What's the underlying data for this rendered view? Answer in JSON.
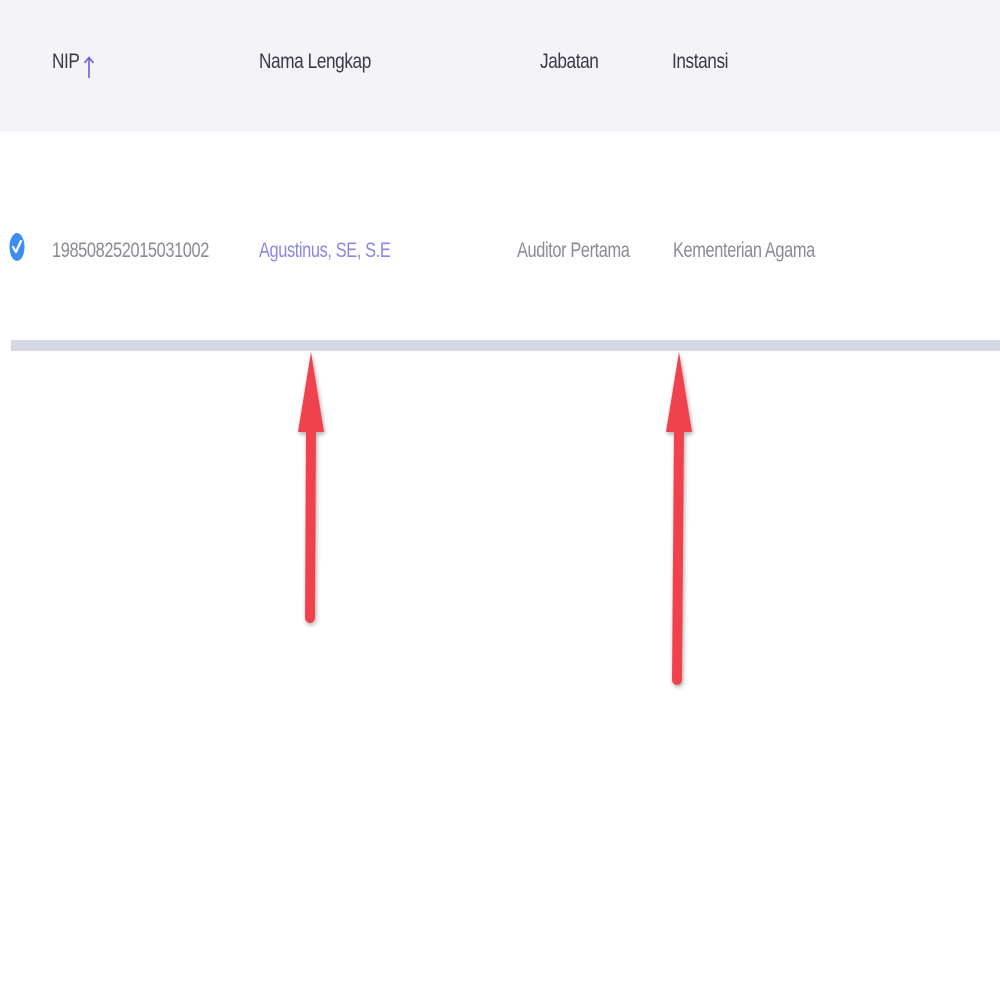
{
  "table": {
    "columns": {
      "nip": "NIP",
      "nama": "Nama Lengkap",
      "jabatan": "Jabatan",
      "instansi": "Instansi"
    },
    "sort": {
      "column": "NIP",
      "direction": "ascending",
      "icon": "arrow-up-icon"
    },
    "rows": [
      {
        "selected": true,
        "nip": "198508252015031002",
        "nama": "Agustinus, SE, S.E",
        "jabatan": "Auditor Pertama",
        "instansi": "Kementerian Agama"
      }
    ]
  },
  "colors": {
    "header_bg": "#f3f3f8",
    "link": "#8a86e6",
    "check": "#3d8ef0",
    "annotation_arrow": "#f0434d",
    "scrollbar": "#d3d8e2"
  },
  "annotations": {
    "arrows": [
      "annotation-arrow-icon",
      "annotation-arrow-icon"
    ]
  }
}
